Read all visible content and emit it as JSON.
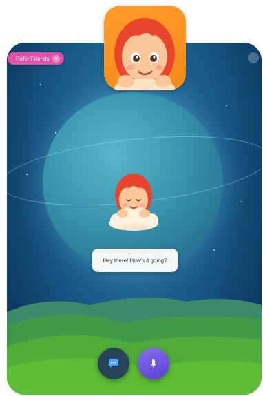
{
  "colors": {
    "icon_orange": "#f58a1a",
    "pill_pink": "#e34fa7",
    "bubble_bg": "#f4f7f8",
    "chat_button": "#28445a",
    "mic_button": "#6b4ee0"
  },
  "top_bar": {
    "referral_label": "Refer Friends",
    "close_icon": "close-icon",
    "menu_icon": "more-icon"
  },
  "app_icon": {
    "icon": "girl-avatar-icon"
  },
  "character": {
    "icon": "girl-on-cloud-avatar"
  },
  "speech_bubble": {
    "text": "Hey there! How's it going?"
  },
  "controls": {
    "chat_icon": "chat-bubble-icon",
    "mic_icon": "microphone-icon"
  }
}
